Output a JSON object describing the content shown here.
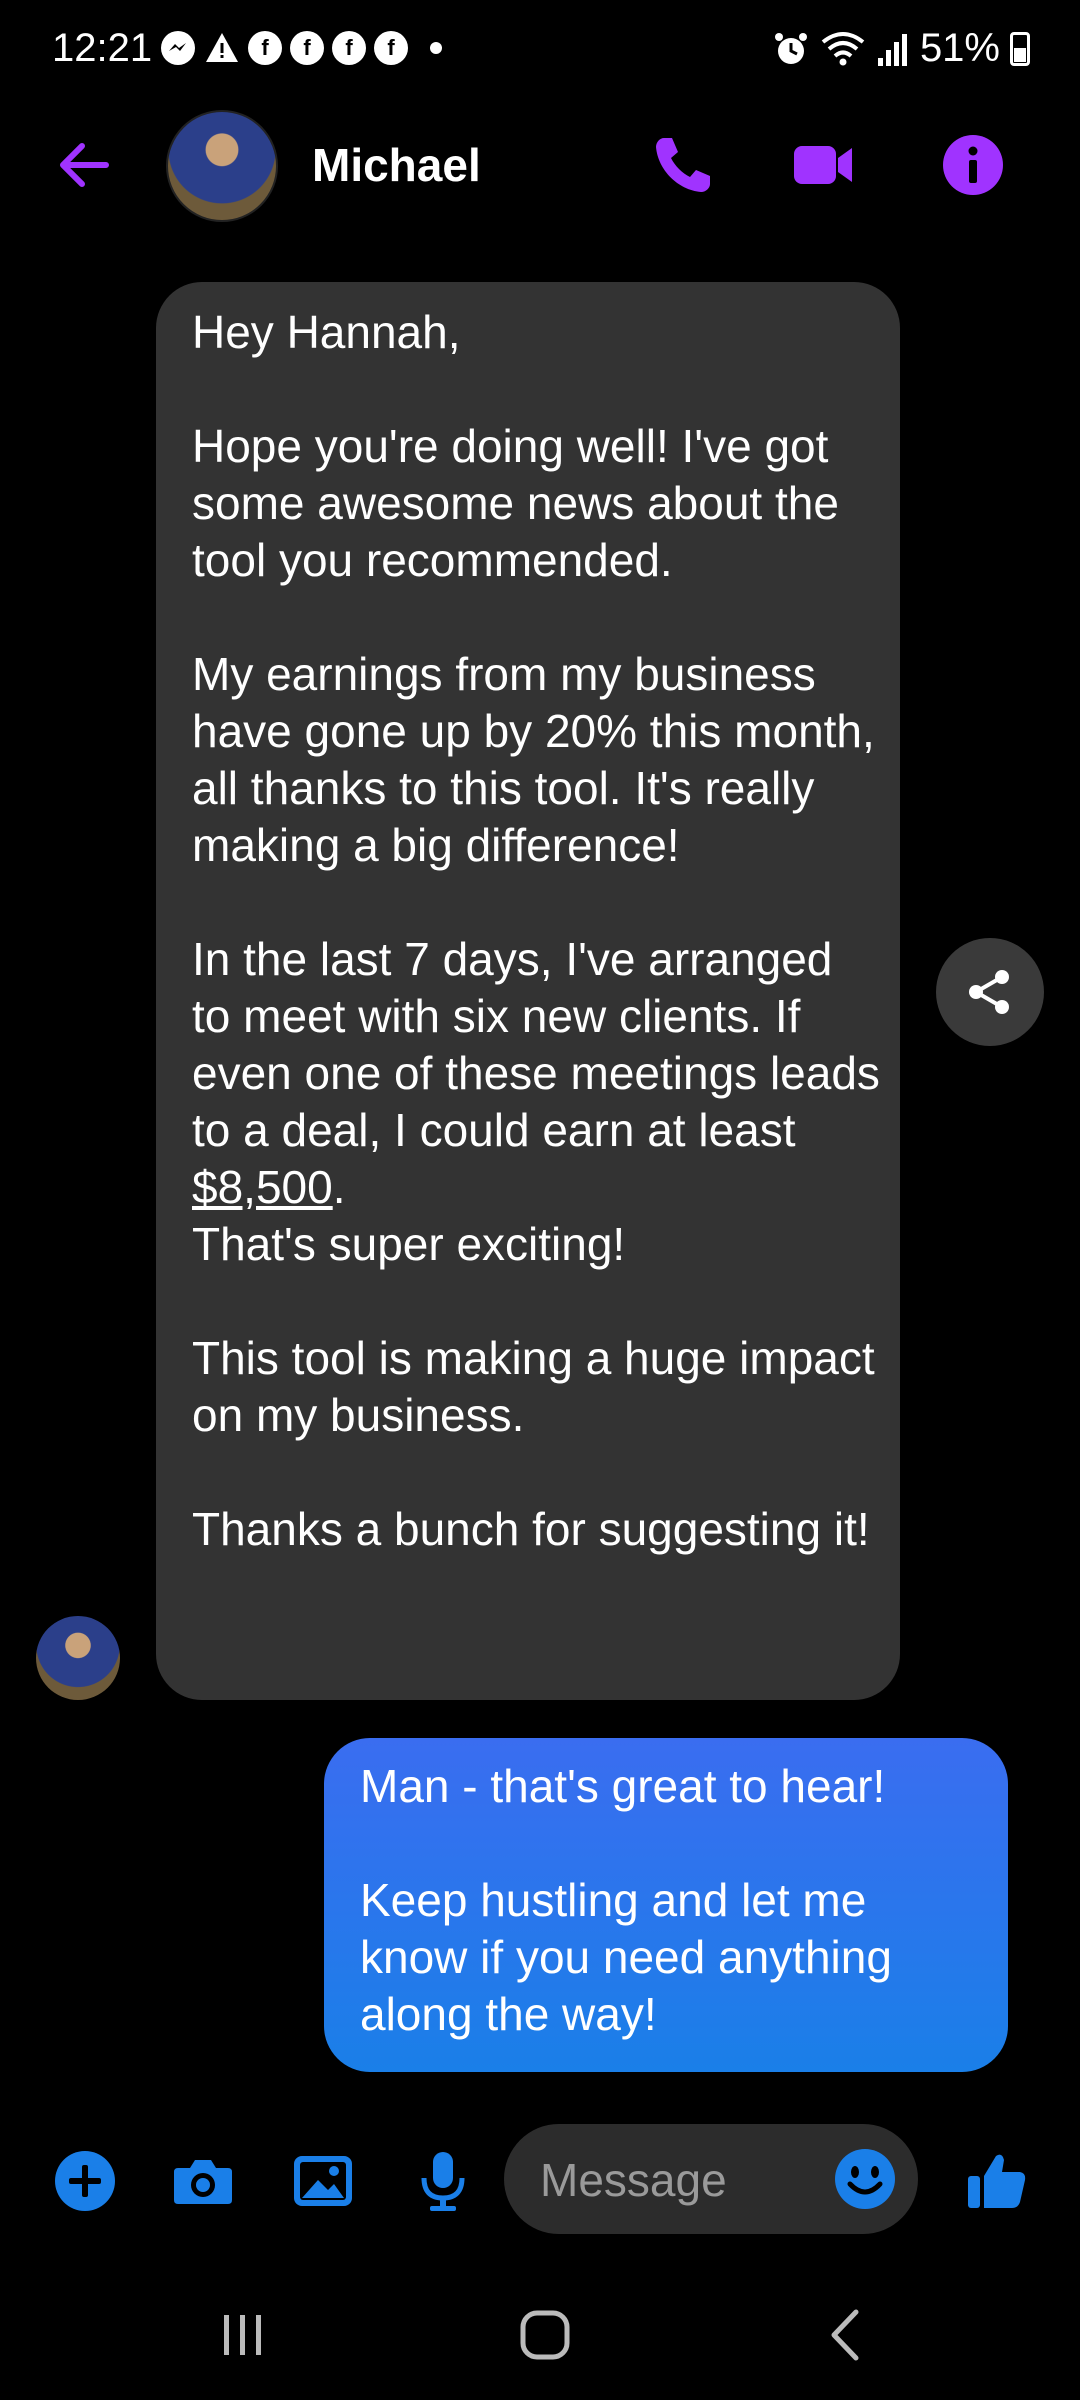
{
  "status_bar": {
    "time": "12:21",
    "battery": "51%",
    "notification_icons": [
      "messenger-icon",
      "warning-icon",
      "facebook-icon",
      "facebook-icon",
      "facebook-icon",
      "facebook-icon"
    ]
  },
  "header": {
    "contact_name": "Michael",
    "accent_color": "#a033ff"
  },
  "messages": {
    "incoming": {
      "text_before_amount": "Hey Hannah,\n\nHope you're doing well! I've got some awesome news about the tool you recommended.\n\nMy earnings from my business have gone up by 20% this month, all thanks to this tool. It's really making a big difference!\n\nIn the last 7 days, I've arranged to meet with six new clients. If even one of these meetings leads to a deal, I could earn at least ",
      "amount": "$8,500",
      "text_after_amount": ".\nThat's super exciting!\n\nThis tool is making a huge impact on my business.\n\nThanks a bunch for suggesting it!"
    },
    "outgoing": {
      "text": "Man - that's great to hear!\n\nKeep hustling and let me know if you need anything along the way!"
    }
  },
  "composer": {
    "placeholder": "Message",
    "accent_color": "#1a7fe8"
  }
}
